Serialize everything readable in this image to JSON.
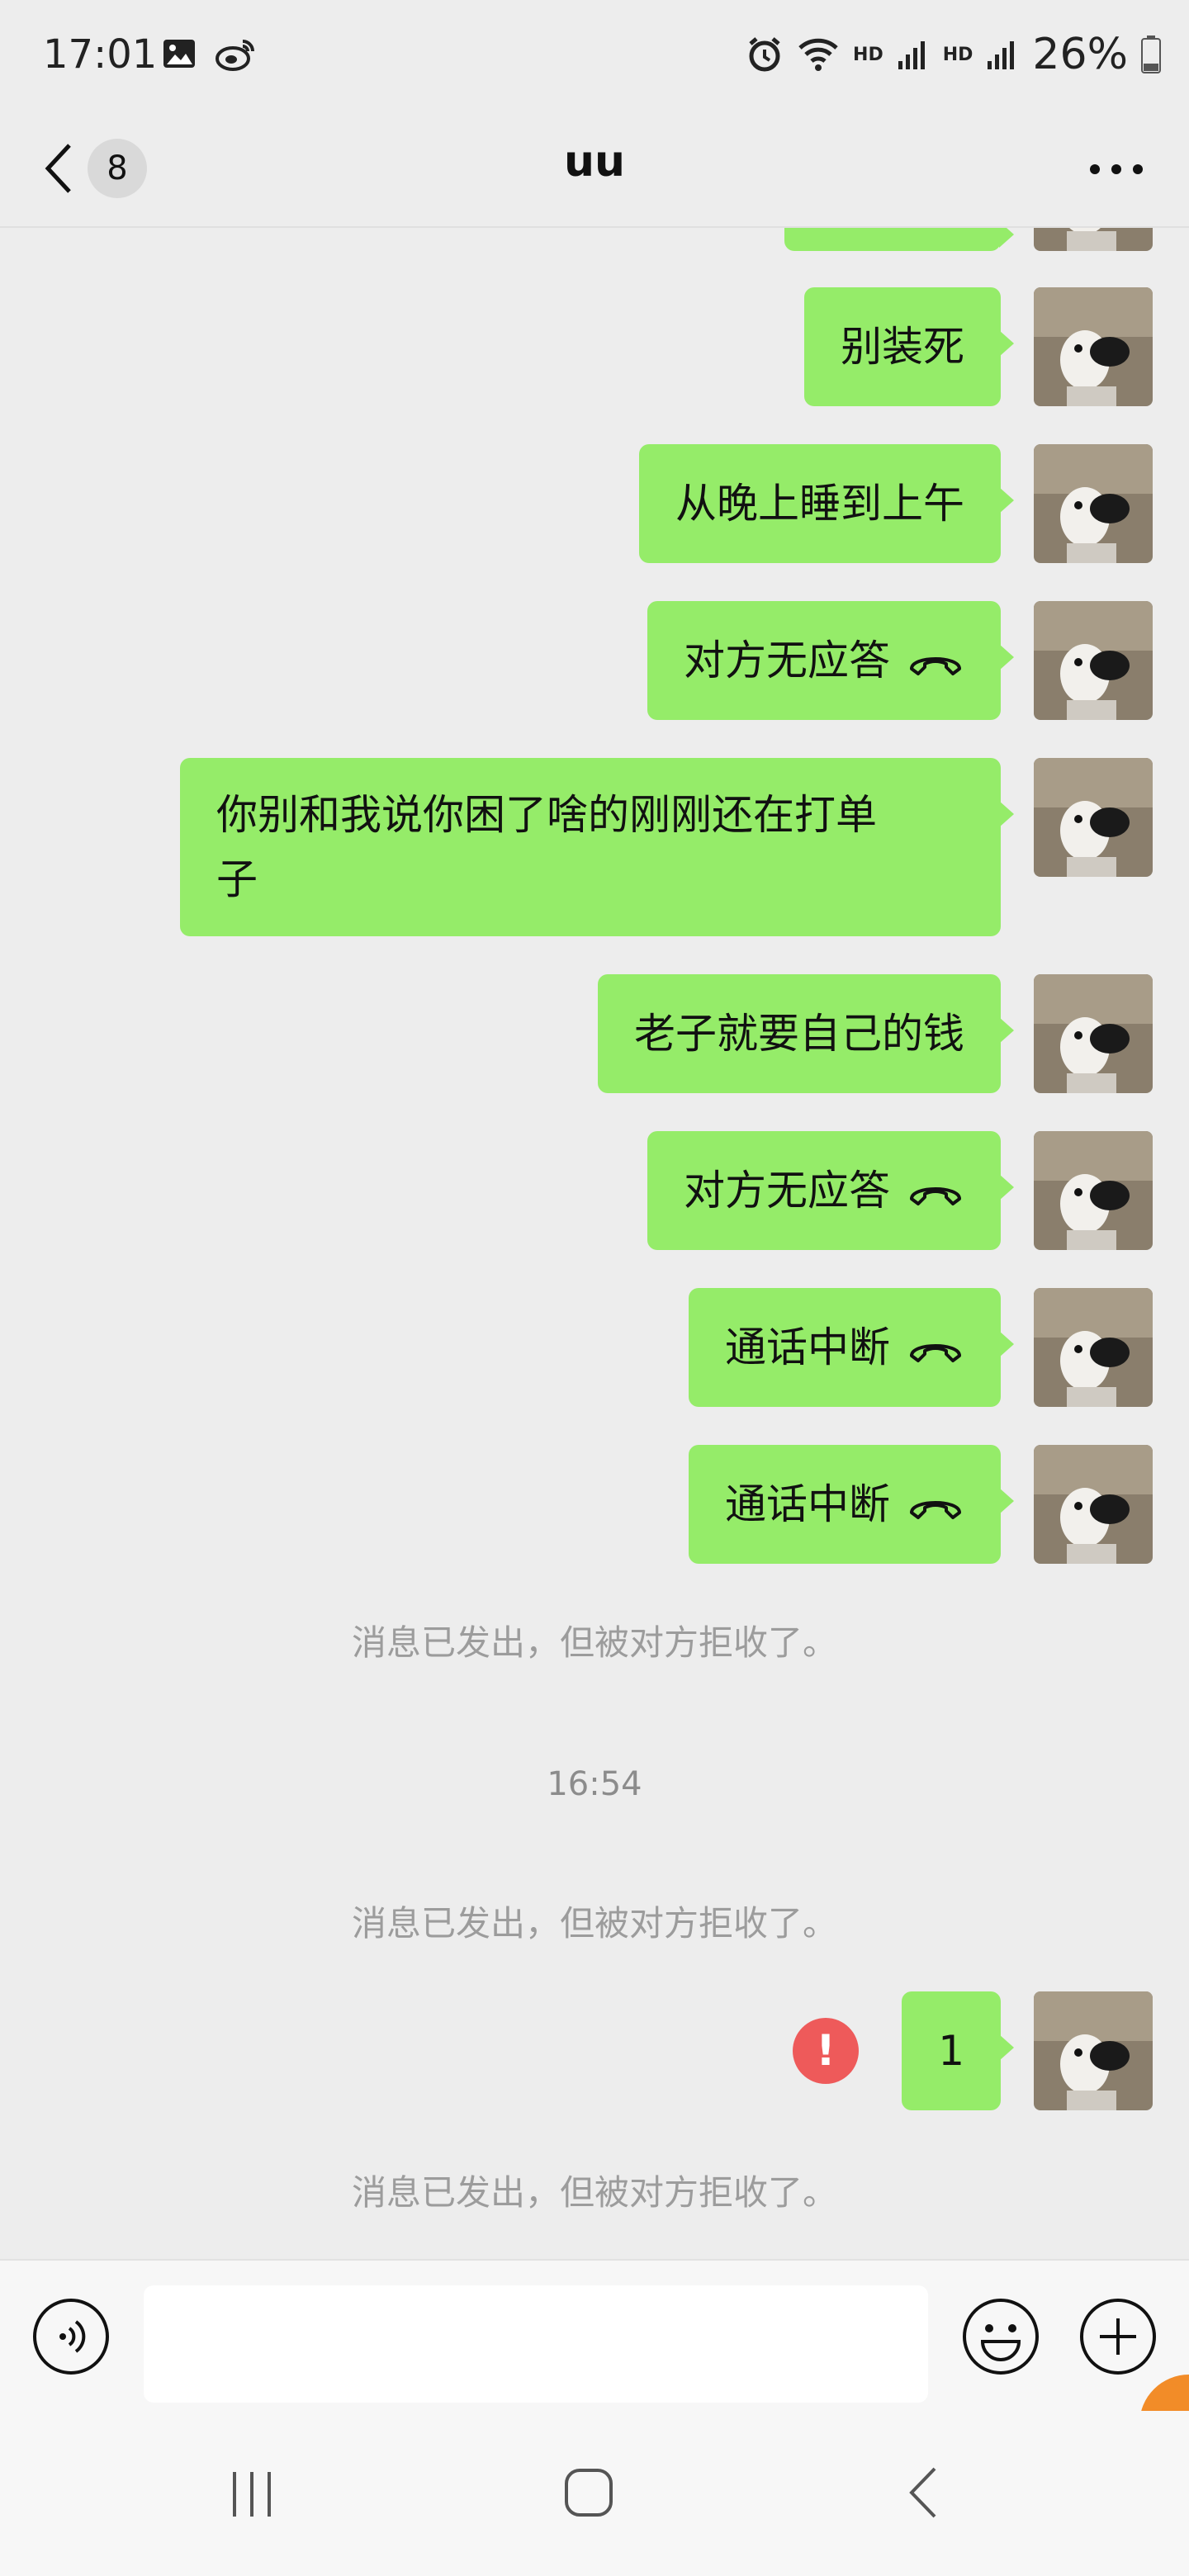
{
  "status_bar": {
    "time": "17:01",
    "icons_left": [
      "image-icon",
      "weibo-icon"
    ],
    "icons_right": [
      "alarm-icon",
      "wifi-icon",
      "signal-icon",
      "signal-icon"
    ],
    "hd_label_1": "HD",
    "hd_label_2": "HD",
    "battery": "26%"
  },
  "header": {
    "unread_count": "8",
    "title": "uu",
    "more_icon": "more-horizontal-icon"
  },
  "messages": [
    {
      "type": "text",
      "text": "别装死"
    },
    {
      "type": "text",
      "text": "从晚上睡到上午"
    },
    {
      "type": "call",
      "text": "对方无应答",
      "icon": "call-end-icon"
    },
    {
      "type": "text",
      "line1": "你别和我说你困了啥的刚刚还在打单",
      "line2": "子"
    },
    {
      "type": "text",
      "text": "老子就要自己的钱"
    },
    {
      "type": "call",
      "text": "对方无应答",
      "icon": "call-end-icon"
    },
    {
      "type": "call",
      "text": "通话中断",
      "icon": "call-end-icon"
    },
    {
      "type": "call",
      "text": "通话中断",
      "icon": "call-end-icon"
    },
    {
      "type": "system",
      "text": "消息已发出，但被对方拒收了。"
    },
    {
      "type": "timestamp",
      "text": "16:54"
    },
    {
      "type": "system",
      "text": "消息已发出，但被对方拒收了。"
    },
    {
      "type": "text",
      "text": "1",
      "failed": true,
      "failed_mark": "!"
    },
    {
      "type": "system",
      "text": "消息已发出，但被对方拒收了。"
    }
  ],
  "input_bar": {
    "voice_icon": "voice-icon",
    "emoji_icon": "emoji-icon",
    "plus_icon": "plus-icon",
    "value": ""
  },
  "system_nav": [
    "recents-icon",
    "home-icon",
    "back-icon"
  ],
  "colors": {
    "bubble_sent": "#95ec69",
    "background": "#ededed",
    "failed": "#ee5a5a",
    "system_text": "#9c9c9c"
  }
}
